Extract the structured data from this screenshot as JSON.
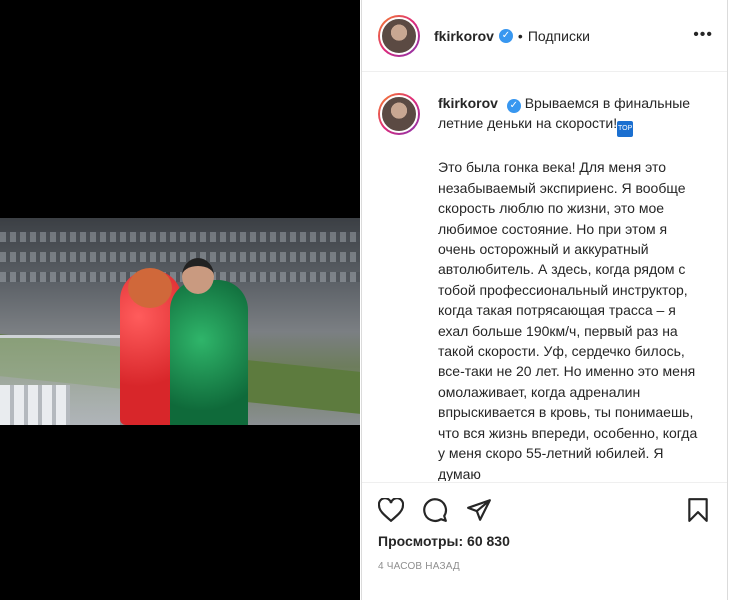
{
  "post": {
    "username": "fkirkorov",
    "verified_icon": "verified-badge-icon",
    "separator": "•",
    "follow_status": "Подписки",
    "more_icon": "more-options-icon",
    "more_glyph": "•••"
  },
  "caption": {
    "username": "fkirkorov",
    "title": "Врываемся в финальные летние деньки на скорости!",
    "flag_icon": "top-flag-icon",
    "flag_text": "TOP",
    "body": "Это была гонка века! Для меня это незабываемый экспириенс. Я вообще скорость люблю по жизни, это мое любимое состояние. Но при этом я очень осторожный и аккуратный автолюбитель. А здесь, когда рядом с тобой профессиональный инструктор, когда такая потрясающая трасса – я ехал больше 190км/ч, первый раз на такой скорости. Уф, сердечко билось, все-таки не 20 лет. Но именно это меня омолаживает, когда адреналин впрыскивается в кровь, ты понимаешь, что вся жизнь впереди, особенно, когда у меня скоро 55-летний юбилей. Я думаю"
  },
  "actions": {
    "like_icon": "heart-icon",
    "comment_icon": "comment-icon",
    "share_icon": "share-icon",
    "save_icon": "bookmark-icon"
  },
  "stats": {
    "views": "Просмотры: 60 830",
    "time_ago": "4 ЧАСОВ НАЗАД"
  },
  "colors": {
    "verified": "#3897f0",
    "text": "#262626",
    "muted": "#8e8e8e"
  }
}
